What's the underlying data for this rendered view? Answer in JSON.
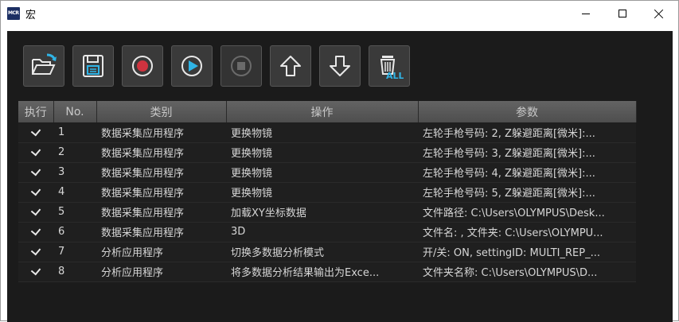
{
  "window": {
    "title": "宏",
    "app_icon_text": "MCR"
  },
  "toolbar": {
    "buttons": [
      {
        "name": "open-macro-button",
        "icon": "folder-open-icon",
        "enabled": true
      },
      {
        "name": "save-macro-button",
        "icon": "save-icon",
        "enabled": true
      },
      {
        "name": "record-button",
        "icon": "record-icon",
        "enabled": true
      },
      {
        "name": "play-button",
        "icon": "play-icon",
        "enabled": true
      },
      {
        "name": "stop-button",
        "icon": "stop-icon",
        "enabled": false
      },
      {
        "name": "move-up-button",
        "icon": "arrow-up-icon",
        "enabled": true
      },
      {
        "name": "move-down-button",
        "icon": "arrow-down-icon",
        "enabled": true
      },
      {
        "name": "delete-all-button",
        "icon": "trash-all-icon",
        "enabled": true,
        "label": "ALL"
      }
    ]
  },
  "table": {
    "headers": {
      "exec": "执行",
      "no": "No.",
      "category": "类别",
      "operation": "操作",
      "params": "参数"
    },
    "rows": [
      {
        "no": "1",
        "category": "数据采集应用程序",
        "operation": "更换物镜",
        "params": "左轮手枪号码: 2, Z躲避距离[微米]:...",
        "checked": true
      },
      {
        "no": "2",
        "category": "数据采集应用程序",
        "operation": "更换物镜",
        "params": "左轮手枪号码: 3, Z躲避距离[微米]:...",
        "checked": true
      },
      {
        "no": "3",
        "category": "数据采集应用程序",
        "operation": "更换物镜",
        "params": "左轮手枪号码: 4, Z躲避距离[微米]:...",
        "checked": true
      },
      {
        "no": "4",
        "category": "数据采集应用程序",
        "operation": "更换物镜",
        "params": "左轮手枪号码: 5, Z躲避距离[微米]:...",
        "checked": true
      },
      {
        "no": "5",
        "category": "数据采集应用程序",
        "operation": "加载XY坐标数据",
        "params": "文件路径: C:\\Users\\OLYMPUS\\Desk...",
        "checked": true
      },
      {
        "no": "6",
        "category": "数据采集应用程序",
        "operation": "3D",
        "params": "文件名: , 文件夹: C:\\Users\\OLYMPU...",
        "checked": true
      },
      {
        "no": "7",
        "category": "分析应用程序",
        "operation": "切换多数据分析模式",
        "params": "开/关: ON, settingID: MULTI_REP_...",
        "checked": true
      },
      {
        "no": "8",
        "category": "分析应用程序",
        "operation": "将多数据分析结果输出为Exce...",
        "params": "文件夹名称: C:\\Users\\OLYMPUS\\D...",
        "checked": true
      }
    ]
  },
  "colors": {
    "client_bg": "#1b1b1b",
    "accent_cyan": "#2fb4e6",
    "record_red": "#d0333f"
  }
}
